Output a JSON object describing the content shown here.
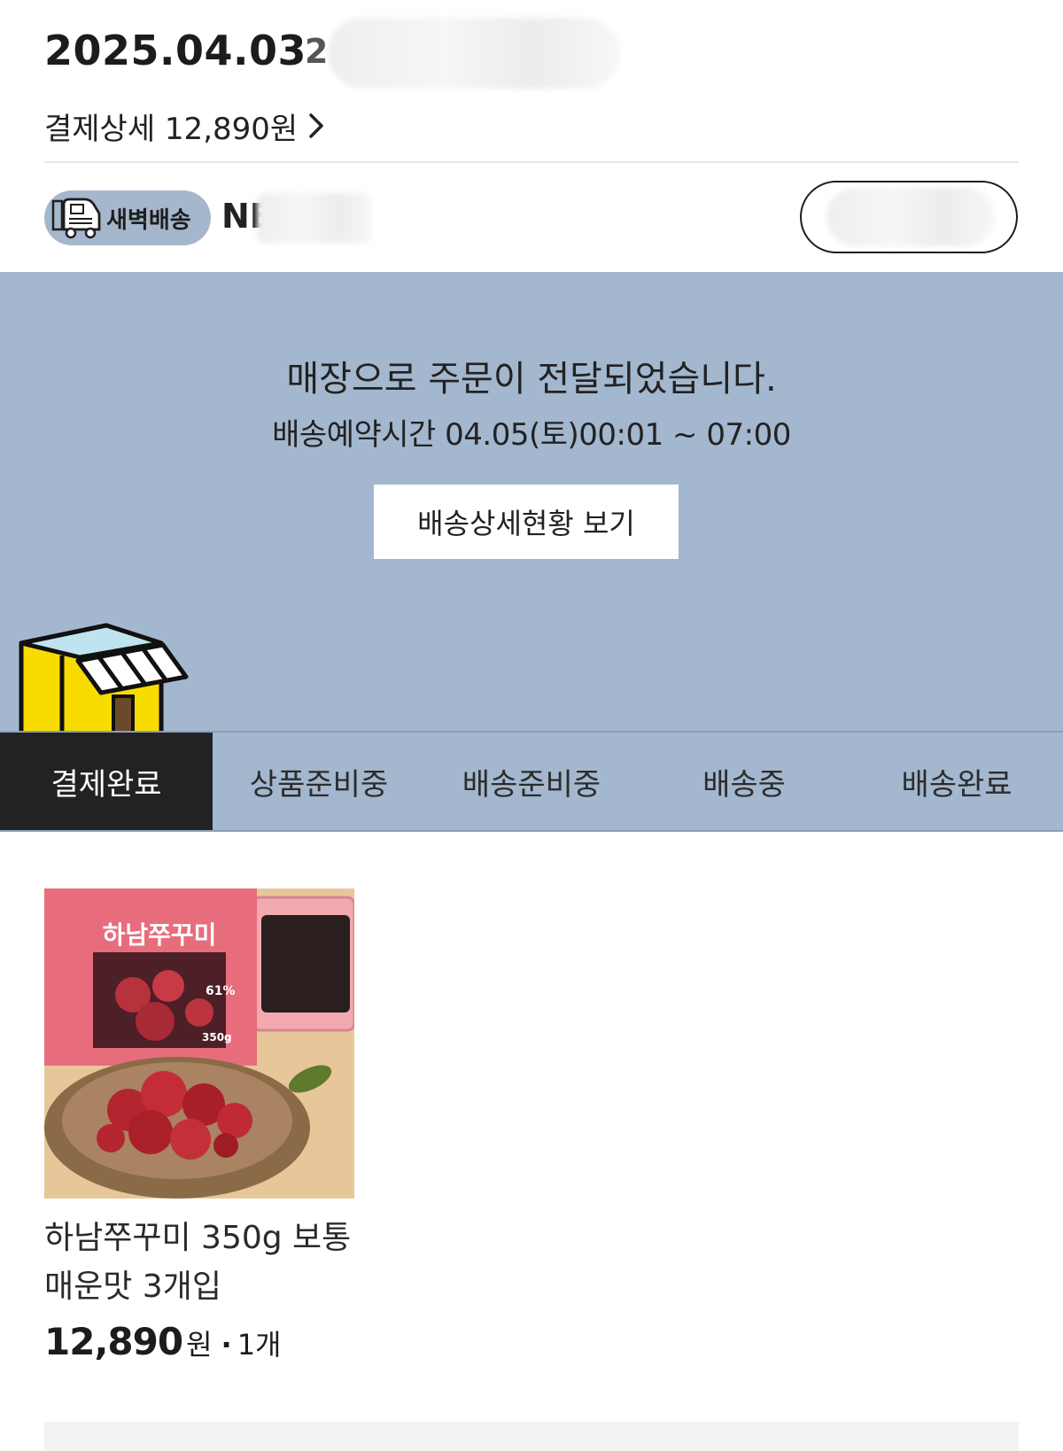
{
  "order": {
    "date": "2025.04.03",
    "date_extra": "2",
    "pay_detail_label": "결제상세 12,890원"
  },
  "delivery": {
    "badge_label": "새벽배송",
    "store_name": "NE",
    "button_label": "S"
  },
  "status": {
    "title": "매장으로 주문이 전달되었습니다.",
    "schedule": "배송예약시간 04.05(토)00:01 ~ 07:00",
    "detail_button": "배송상세현황 보기"
  },
  "steps": [
    {
      "label": "결제완료",
      "active": true
    },
    {
      "label": "상품준비중",
      "active": false
    },
    {
      "label": "배송준비중",
      "active": false
    },
    {
      "label": "배송중",
      "active": false
    },
    {
      "label": "배송완료",
      "active": false
    }
  ],
  "product": {
    "package_text": "하남쭈꾸미",
    "package_badge": "61%",
    "package_weight": "350g",
    "name": "하남쭈꾸미 350g 보통매운맛 3개입",
    "price": "12,890",
    "currency": "원",
    "separator": "·",
    "quantity": "1개"
  },
  "colors": {
    "banner": "#a3b7ce",
    "badge": "#a5b7cd",
    "active_step": "#222222",
    "shop_yellow": "#f8dc00"
  }
}
